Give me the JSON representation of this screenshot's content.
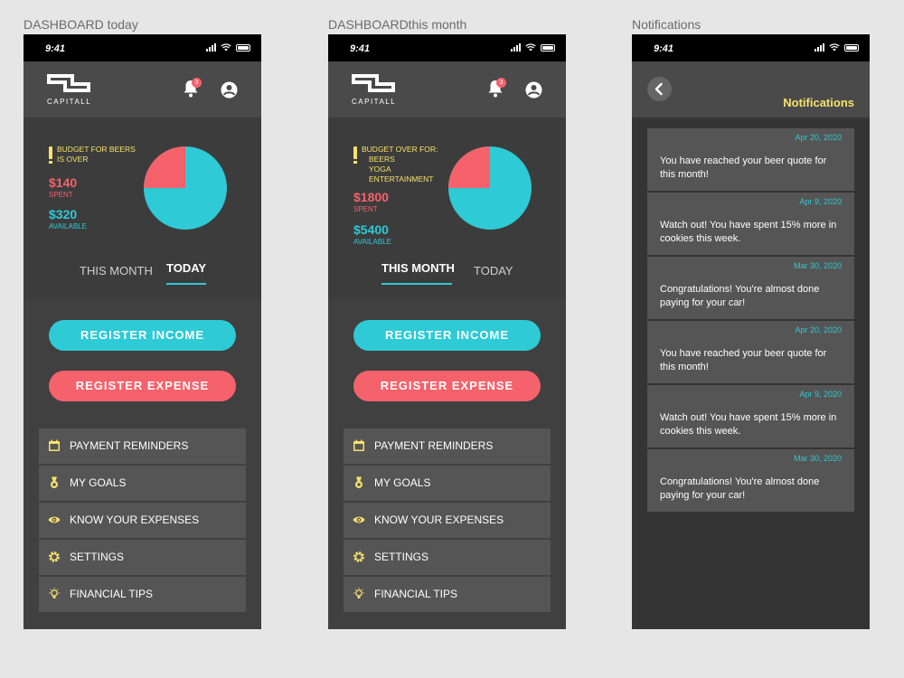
{
  "frames": {
    "today": "DASHBOARD today",
    "month": "DASHBOARDthis month",
    "notifications": "Notifications"
  },
  "status_bar": {
    "time": "9:41"
  },
  "brand": {
    "logo_text": "CAPITALL"
  },
  "notifications_badge": "3",
  "colors": {
    "accent_cyan": "#2ecad6",
    "accent_pink": "#f5626c",
    "warning_yellow": "#f7e26b",
    "background": "#404040"
  },
  "icons": {
    "bell": "bell-icon",
    "profile": "account-circle-icon",
    "back": "chevron-left-icon",
    "calendar": "calendar-icon",
    "medal": "medal-icon",
    "eye": "eye-icon",
    "gear": "gear-icon",
    "bulb": "lightbulb-icon"
  },
  "dashboard_today": {
    "warning": "BUDGET FOR BEERS IS OVER",
    "spent_amount": "$140",
    "spent_label": "SPENT",
    "available_amount": "$320",
    "available_label": "AVAILABLE",
    "spent_fraction": 0.25,
    "tabs": [
      "THIS MONTH",
      "TODAY"
    ],
    "active_tab": "TODAY"
  },
  "dashboard_month": {
    "warning_title": "BUDGET OVER FOR:",
    "warning_items": [
      "BEERS",
      "YOGA",
      "ENTERTAINMENT"
    ],
    "spent_amount": "$1800",
    "spent_label": "SPENT",
    "available_amount": "$5400",
    "available_label": "AVAILABLE",
    "spent_fraction": 0.25,
    "tabs": [
      "THIS MONTH",
      "TODAY"
    ],
    "active_tab": "THIS MONTH"
  },
  "actions": {
    "register_income": "REGISTER INCOME",
    "register_expense": "REGISTER EXPENSE"
  },
  "menu": [
    {
      "label": "PAYMENT REMINDERS",
      "icon": "calendar-icon"
    },
    {
      "label": "MY GOALS",
      "icon": "medal-icon"
    },
    {
      "label": "KNOW YOUR EXPENSES",
      "icon": "eye-icon"
    },
    {
      "label": "SETTINGS",
      "icon": "gear-icon"
    },
    {
      "label": "FINANCIAL TIPS",
      "icon": "lightbulb-icon"
    }
  ],
  "notifications": {
    "title": "Notifications",
    "items": [
      {
        "date": "Apr 20, 2020",
        "text": "You have reached your  beer quote for this month!"
      },
      {
        "date": "Apr 9, 2020",
        "text": "Watch out! You have spent 15% more in cookies this week."
      },
      {
        "date": "Mar 30, 2020",
        "text": "Congratulations! You're almost done paying for your car!"
      },
      {
        "date": "Apr 20, 2020",
        "text": "You have reached your  beer quote for this month!"
      },
      {
        "date": "Apr 9, 2020",
        "text": "Watch out! You have spent 15% more in cookies this week."
      },
      {
        "date": "Mar 30, 2020",
        "text": "Congratulations! You're almost done paying for your car!"
      }
    ]
  }
}
